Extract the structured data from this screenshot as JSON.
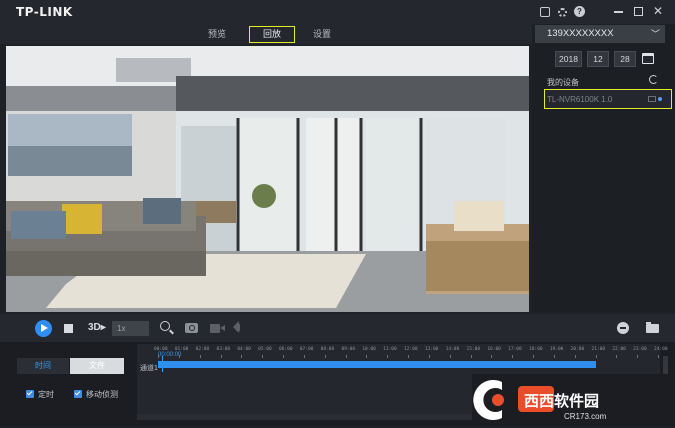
{
  "app": {
    "logo": "TP-LINK"
  },
  "tabs": [
    {
      "label": "预览"
    },
    {
      "label": "回放"
    },
    {
      "label": "设置"
    }
  ],
  "account": {
    "label": "139XXXXXXXX"
  },
  "date": {
    "year": "2018",
    "month": "12",
    "day": "28"
  },
  "devices": {
    "title": "我的设备",
    "items": [
      {
        "name": "TL-NVR6100K 1.0"
      }
    ]
  },
  "controls": {
    "speed": "1x",
    "frame_label": "3D"
  },
  "filter_tabs": {
    "time": "时间",
    "file": "文件"
  },
  "checks": {
    "timed": "定时",
    "motion": "移动侦测"
  },
  "timeline": {
    "cursor": "00:00:00",
    "channel": "通道1",
    "ticks": [
      "00:00",
      "01:00",
      "02:00",
      "03:00",
      "04:00",
      "05:00",
      "06:00",
      "07:00",
      "08:00",
      "09:00",
      "10:00",
      "11:00",
      "12:00",
      "13:00",
      "14:00",
      "15:00",
      "16:00",
      "17:00",
      "18:00",
      "19:00",
      "20:00",
      "21:00",
      "22:00",
      "23:00",
      "24:00"
    ],
    "recording": {
      "start": "00:00",
      "end": "21:00"
    }
  },
  "watermark": {
    "text": "西西软件园",
    "sub": "CR173.com"
  },
  "colors": {
    "accent": "#2f8ff0",
    "highlight": "#e3eb2c"
  },
  "icons": {
    "window": [
      "settings-square-icon",
      "gear-icon",
      "help-icon",
      "minimize-icon",
      "maximize-icon",
      "close-icon"
    ],
    "controls": [
      "play-icon",
      "stop-icon",
      "zoom-icon",
      "camera-icon",
      "record-icon",
      "volume-icon",
      "minus-icon",
      "folder-icon"
    ]
  }
}
